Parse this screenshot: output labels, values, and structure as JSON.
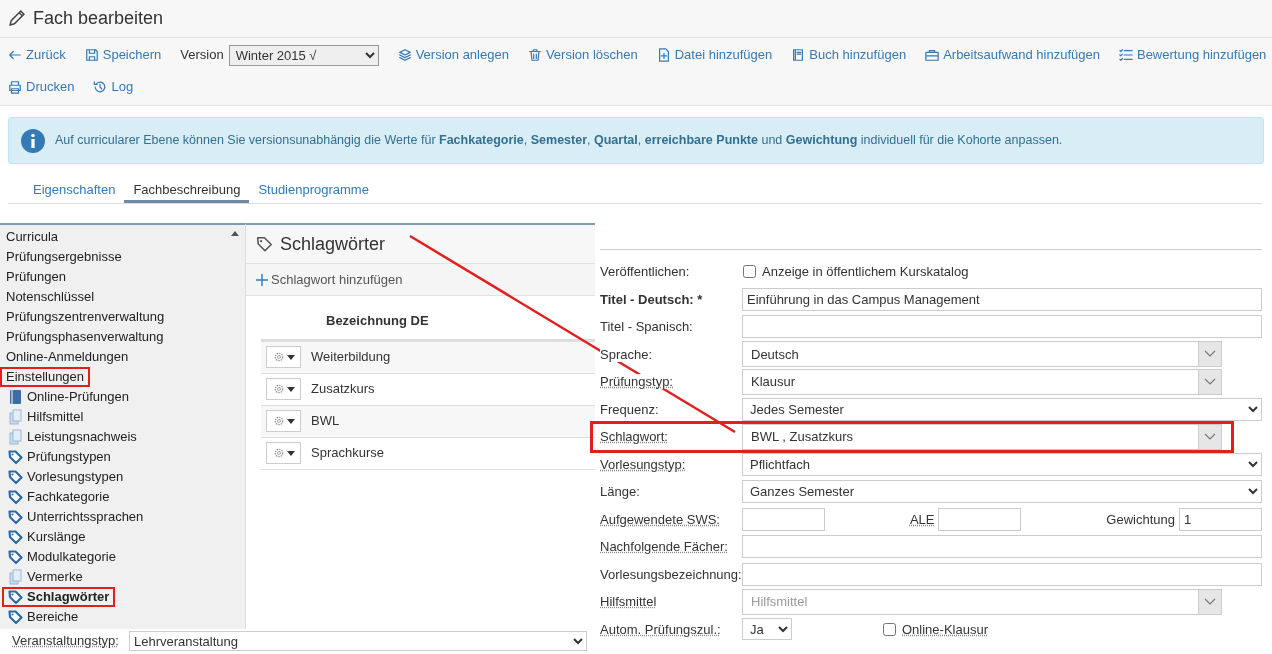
{
  "page_title": "Fach bearbeiten",
  "toolbar_rows": [
    [
      {
        "kind": "button",
        "label": "Zurück"
      },
      {
        "kind": "button",
        "label": "Speichern"
      },
      {
        "kind": "select",
        "label": "Version",
        "value": "Winter 2015 √"
      },
      {
        "kind": "button",
        "label": "Version anlegen"
      },
      {
        "kind": "button",
        "label": "Version löschen"
      },
      {
        "kind": "button",
        "label": "Datei hinzufügen"
      },
      {
        "kind": "button",
        "label": "Buch hinzufügen"
      },
      {
        "kind": "button",
        "label": "Arbeitsaufwand hinzufügen"
      },
      {
        "kind": "button",
        "label": "Bewertung hinzufügen"
      }
    ],
    [
      {
        "kind": "button",
        "label": "Drucken"
      },
      {
        "kind": "button",
        "label": "Log"
      }
    ]
  ],
  "alert": {
    "text": "Auf curricularer Ebene können Sie versionsunabhängig die Werte für **Fachkategorie**, **Semester**, **Quartal**, **erreichbare Punkte** und **Gewichtung** individuell für die Kohorte anpassen."
  },
  "tabs": [
    {
      "label": "Eigenschaften",
      "selected": false
    },
    {
      "label": "Fachbeschreibung",
      "selected": true
    },
    {
      "label": "Studienprogramme",
      "selected": false
    }
  ],
  "menu": {
    "items": [
      {
        "label": "Curricula",
        "kind": "plain",
        "selected": false,
        "highlighted": false
      },
      {
        "label": "Prüfungsergebnisse",
        "kind": "plain",
        "selected": false,
        "highlighted": false
      },
      {
        "label": "Prüfungen",
        "kind": "plain",
        "selected": false,
        "highlighted": false
      },
      {
        "label": "Notenschlüssel",
        "kind": "plain",
        "selected": false,
        "highlighted": false
      },
      {
        "label": "Prüfungszentrenverwaltung",
        "kind": "plain",
        "selected": false,
        "highlighted": false
      },
      {
        "label": "Prüfungsphasenverwaltung",
        "kind": "plain",
        "selected": false,
        "highlighted": false
      },
      {
        "label": "Online-Anmeldungen",
        "kind": "plain",
        "selected": false,
        "highlighted": false
      },
      {
        "label": "Einstellungen",
        "kind": "plain",
        "selected": false,
        "highlighted": true
      },
      {
        "label": "Online-Prüfungen",
        "kind": "book",
        "selected": false,
        "highlighted": false
      },
      {
        "label": "Hilfsmittel",
        "kind": "clipboard",
        "selected": false,
        "highlighted": false
      },
      {
        "label": "Leistungsnachweis",
        "kind": "clipboard",
        "selected": false,
        "highlighted": false
      },
      {
        "label": "Prüfungstypen",
        "kind": "tag",
        "selected": false,
        "highlighted": false
      },
      {
        "label": "Vorlesungstypen",
        "kind": "tag",
        "selected": false,
        "highlighted": false
      },
      {
        "label": "Fachkategorie",
        "kind": "tag",
        "selected": false,
        "highlighted": false
      },
      {
        "label": "Unterrichtssprachen",
        "kind": "tag",
        "selected": false,
        "highlighted": false
      },
      {
        "label": "Kurslänge",
        "kind": "tag",
        "selected": false,
        "highlighted": false
      },
      {
        "label": "Modulkategorie",
        "kind": "tag",
        "selected": false,
        "highlighted": false
      },
      {
        "label": "Vermerke",
        "kind": "clipboard",
        "selected": false,
        "highlighted": false
      },
      {
        "label": "Schlagwörter",
        "kind": "tag",
        "selected": true,
        "highlighted": true
      },
      {
        "label": "Bereiche",
        "kind": "tag",
        "selected": false,
        "highlighted": false
      }
    ]
  },
  "keyword_panel": {
    "title": "Schlagwörter",
    "add_button": "Schlagwort hinzufügen",
    "column": "Bezeichnung DE",
    "rows": [
      "Weiterbildung",
      "Zusatzkurs",
      "BWL",
      "Sprachkurse"
    ]
  },
  "bottom_field": {
    "label": "Veranstaltungstyp:",
    "value": "Lehrveranstaltung"
  },
  "form": {
    "rows": [
      {
        "kind": "checkbox",
        "label": "Veröffentlichen:",
        "option": "Anzeige in öffentlichem Kurskatalog",
        "checked": false,
        "underlined": false,
        "bold": false,
        "highlighted": false
      },
      {
        "kind": "input",
        "label": "Titel - Deutsch: *",
        "value": "Einführung in das Campus Management",
        "underlined": false,
        "bold": true,
        "highlighted": false
      },
      {
        "kind": "input",
        "label": "Titel - Spanisch:",
        "underlined": false,
        "bold": false,
        "highlighted": false
      },
      {
        "kind": "combo",
        "label": "Sprache:",
        "value": "Deutsch",
        "underlined": false,
        "bold": false,
        "highlighted": false
      },
      {
        "kind": "combo",
        "label": "Prüfungstyp:",
        "value": "Klausur",
        "underlined": true,
        "bold": false,
        "highlighted": false
      },
      {
        "kind": "select",
        "label": "Frequenz:",
        "value": "Jedes Semester",
        "underlined": false,
        "bold": false,
        "highlighted": false
      },
      {
        "kind": "combo",
        "label": "Schlagwort:",
        "value": "BWL , Zusatzkurs",
        "underlined": true,
        "bold": false,
        "highlighted": true
      },
      {
        "kind": "select",
        "label": "Vorlesungstyp:",
        "value": "Pflichtfach",
        "underlined": true,
        "bold": false,
        "highlighted": false
      },
      {
        "kind": "select",
        "label": "Länge:",
        "value": "Ganzes Semester",
        "underlined": false,
        "bold": false,
        "highlighted": false
      },
      {
        "kind": "triple",
        "label": "Aufgewendete SWS:",
        "underlined": true,
        "bold": false,
        "highlighted": false,
        "fields": [
          {
            "label": "ALE",
            "underlined": true
          },
          {
            "label": "Gewichtung",
            "value": "1",
            "underlined": false
          }
        ]
      },
      {
        "kind": "input",
        "label": "Nachfolgende Fächer:",
        "underlined": true,
        "bold": false,
        "highlighted": false
      },
      {
        "kind": "input",
        "label": "Vorlesungsbezeichnung:",
        "underlined": false,
        "bold": false,
        "highlighted": false
      },
      {
        "kind": "combo",
        "label": "Hilfsmittel",
        "placeholder": "Hilfsmittel",
        "underlined": true,
        "bold": false,
        "highlighted": false
      },
      {
        "kind": "inline",
        "label": "Autom.  Prüfungszul.:",
        "value": "Ja",
        "option": "Online-Klausur",
        "checked": false,
        "option_underlined": true,
        "underlined": true,
        "bold": false,
        "highlighted": false
      }
    ]
  }
}
